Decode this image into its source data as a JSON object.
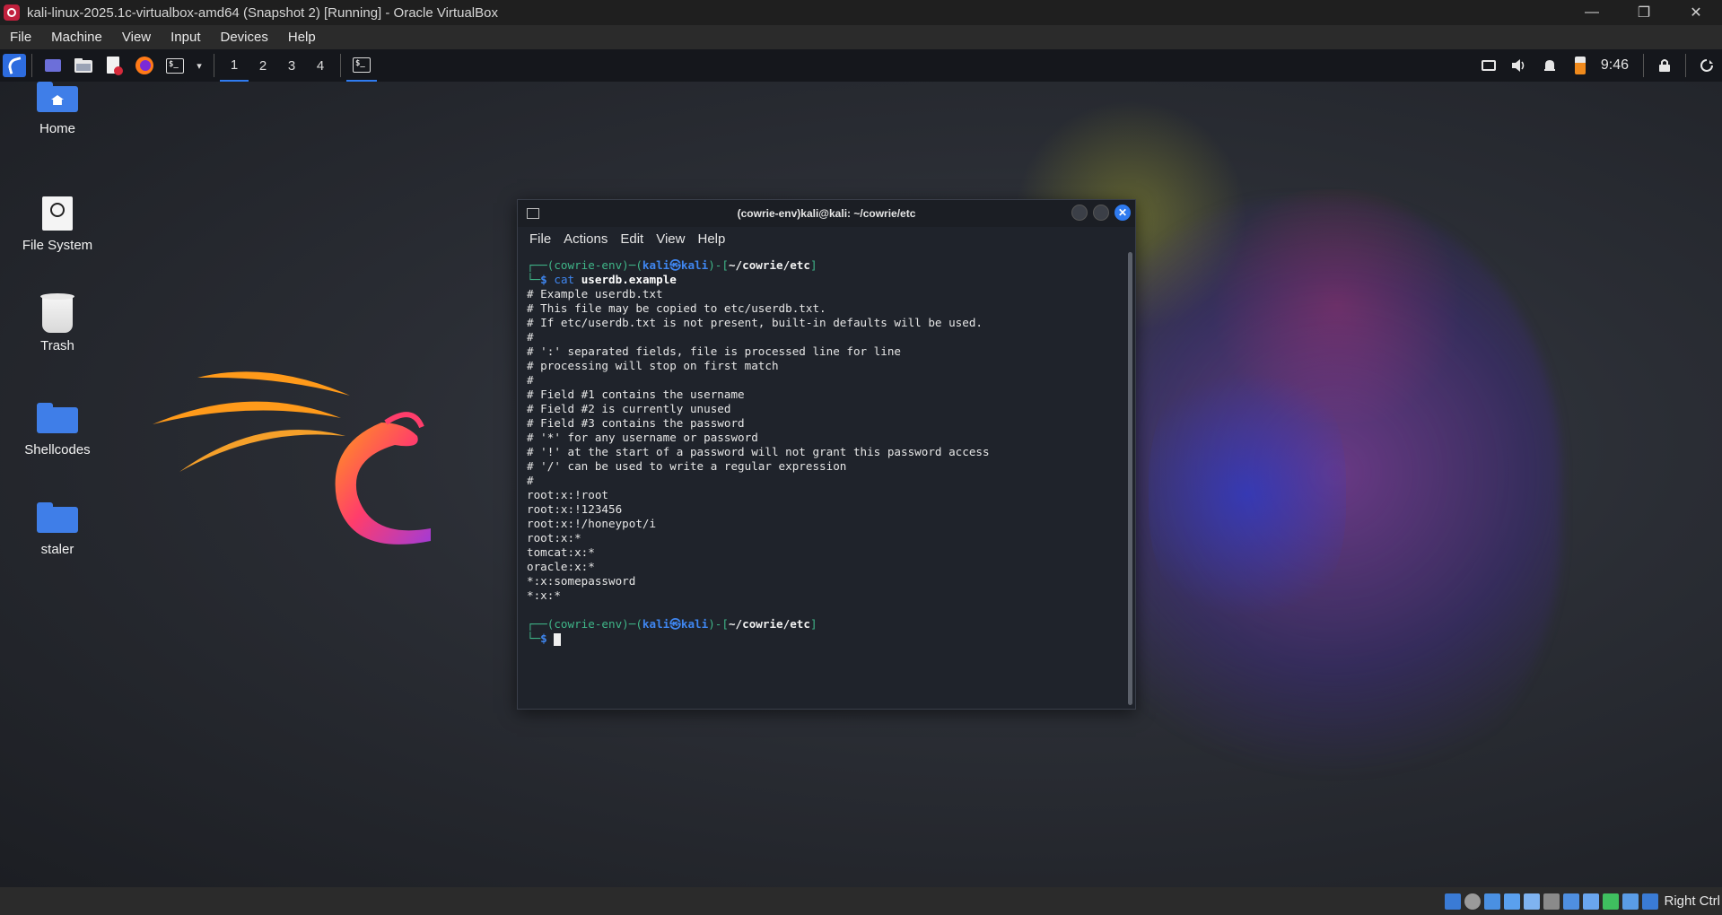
{
  "window": {
    "title": "kali-linux-2025.1c-virtualbox-amd64 (Snapshot 2) [Running] - Oracle VirtualBox",
    "controls": [
      "—",
      "❐",
      "✕"
    ]
  },
  "vbox_menu": [
    "File",
    "Machine",
    "View",
    "Input",
    "Devices",
    "Help"
  ],
  "panel": {
    "workspaces": [
      "1",
      "2",
      "3",
      "4"
    ],
    "active_workspace": "1",
    "clock": "9:46",
    "launcher_icons": [
      "kali-menu-icon",
      "desktop-icon",
      "file-manager-icon",
      "text-editor-icon",
      "firefox-icon",
      "terminal-icon"
    ],
    "tray_icons": [
      "display-icon",
      "volume-icon",
      "notification-bell-icon",
      "battery-icon",
      "lock-icon",
      "logout-icon"
    ],
    "accent": "#2f7bf0"
  },
  "desktop_icons": [
    {
      "label": "Home",
      "icon": "home-folder-icon"
    },
    {
      "label": "File System",
      "icon": "drive-icon"
    },
    {
      "label": "Trash",
      "icon": "trash-icon"
    },
    {
      "label": "Shellcodes",
      "icon": "folder-icon"
    },
    {
      "label": "staler",
      "icon": "folder-icon"
    }
  ],
  "terminal": {
    "title": "(cowrie-env)kali@kali: ~/cowrie/etc",
    "menu": [
      "File",
      "Actions",
      "Edit",
      "View",
      "Help"
    ],
    "prompt": {
      "env": "(cowrie-env)",
      "user": "kali",
      "at": "㉿",
      "host": "kali",
      "path": "~/cowrie/etc",
      "symbol": "$"
    },
    "command": "cat",
    "command_arg": "userdb.example",
    "output": [
      "# Example userdb.txt",
      "# This file may be copied to etc/userdb.txt.",
      "# If etc/userdb.txt is not present, built-in defaults will be used.",
      "#",
      "# ':' separated fields, file is processed line for line",
      "# processing will stop on first match",
      "#",
      "# Field #1 contains the username",
      "# Field #2 is currently unused",
      "# Field #3 contains the password",
      "# '*' for any username or password",
      "# '!' at the start of a password will not grant this password access",
      "# '/' can be used to write a regular expression",
      "#",
      "root:x:!root",
      "root:x:!123456",
      "root:x:!/honeypot/i",
      "root:x:*",
      "tomcat:x:*",
      "oracle:x:*",
      "*:x:somepassword",
      "*:x:*"
    ]
  },
  "status_bar": {
    "host_key": "Right Ctrl"
  }
}
